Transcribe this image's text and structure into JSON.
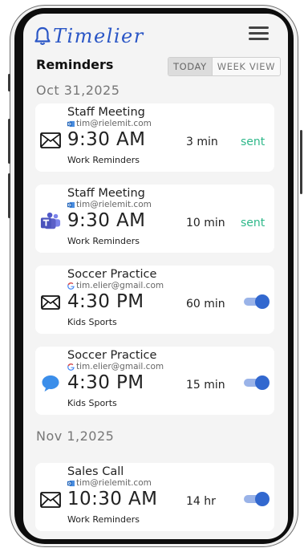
{
  "app": {
    "name": "Timelier"
  },
  "header": {
    "title": "Reminders",
    "tabs": [
      "TODAY",
      "WEEK VIEW"
    ],
    "active_tab": "TODAY"
  },
  "groups": [
    {
      "date": "Oct 31,2025"
    },
    {
      "date": "Nov 1,2025"
    }
  ],
  "reminders": [
    {
      "title": "Staff Meeting",
      "account": "tim@rielemit.com",
      "account_icon": "outlook-icon",
      "channel_icon": "envelope-icon",
      "time": "9:30 AM",
      "category": "Work Reminders",
      "lead": "3 min",
      "status": "sent"
    },
    {
      "title": "Staff Meeting",
      "account": "tim@rielemit.com",
      "account_icon": "outlook-icon",
      "channel_icon": "teams-icon",
      "time": "9:30 AM",
      "category": "Work Reminders",
      "lead": "10 min",
      "status": "sent"
    },
    {
      "title": "Soccer Practice",
      "account": "tim.elier@gmail.com",
      "account_icon": "google-icon",
      "channel_icon": "envelope-icon",
      "time": "4:30 PM",
      "category": "Kids Sports",
      "lead": "60 min",
      "enabled": true
    },
    {
      "title": "Soccer Practice",
      "account": "tim.elier@gmail.com",
      "account_icon": "google-icon",
      "channel_icon": "chat-bubble-icon",
      "time": "4:30 PM",
      "category": "Kids Sports",
      "lead": "15 min",
      "enabled": true
    },
    {
      "title": "Sales Call",
      "account": "tim@rielemit.com",
      "account_icon": "outlook-icon",
      "channel_icon": "envelope-icon",
      "time": "10:30 AM",
      "category": "Work Reminders",
      "lead": "14 hr",
      "enabled": true
    }
  ],
  "colors": {
    "brand": "#2a56c6",
    "sent": "#2fb88a",
    "toggle_on": "#3268cf"
  }
}
